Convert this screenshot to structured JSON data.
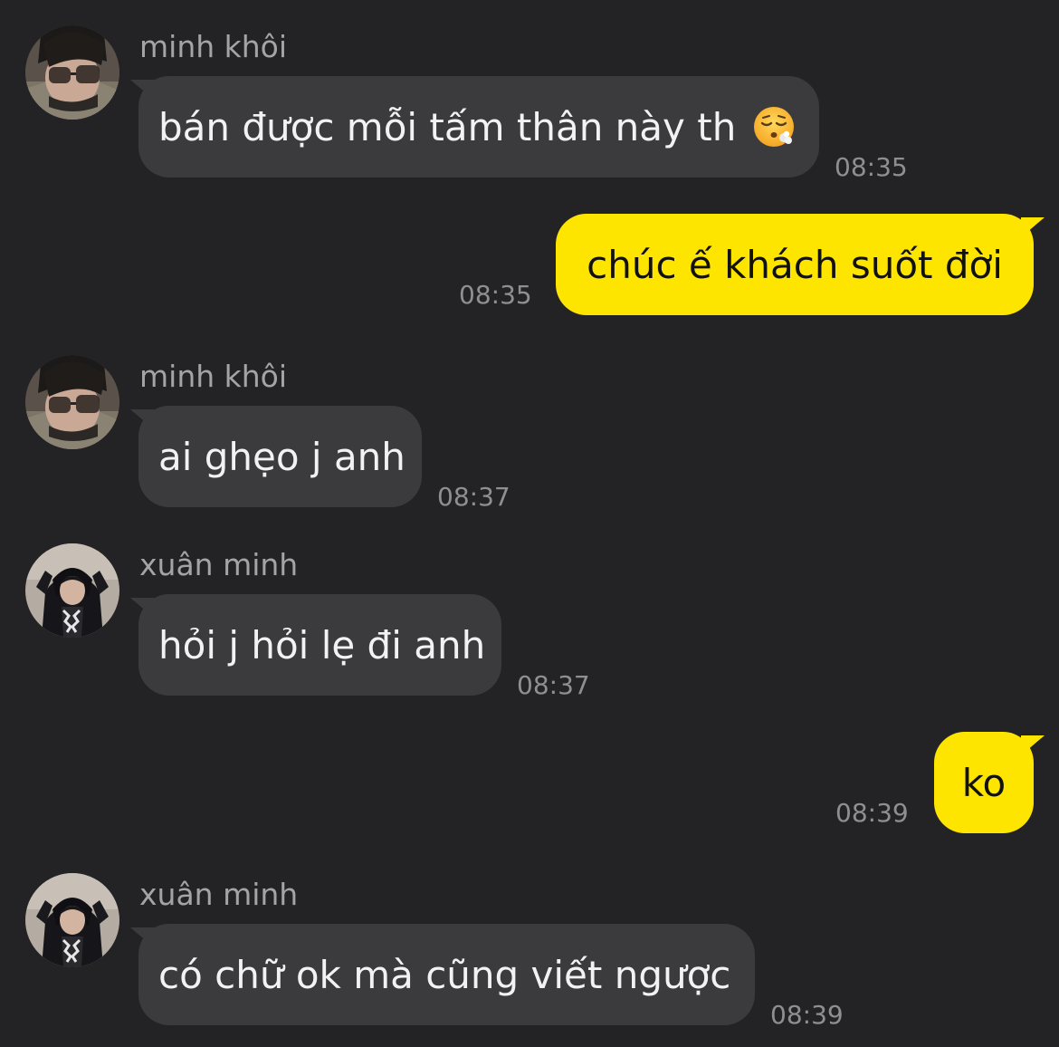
{
  "messages": [
    {
      "sender": "minh khôi",
      "text": "bán được mỗi tấm thân này th",
      "emoji": "exhaling-face-emoji",
      "time": "08:35"
    },
    {
      "text": "chúc ế khách suốt đời",
      "time": "08:35"
    },
    {
      "sender": "minh khôi",
      "text": "ai ghẹo j anh",
      "time": "08:37"
    },
    {
      "sender": "xuân minh",
      "text": "hỏi j hỏi lẹ đi anh",
      "time": "08:37"
    },
    {
      "text": "ko",
      "time": "08:39"
    },
    {
      "sender": "xuân minh",
      "text": "có chữ ok mà cũng viết ngược",
      "time": "08:39"
    }
  ],
  "colors": {
    "background": "#232325",
    "incoming_bubble": "#3b3b3e",
    "outgoing_bubble": "#fee500"
  }
}
